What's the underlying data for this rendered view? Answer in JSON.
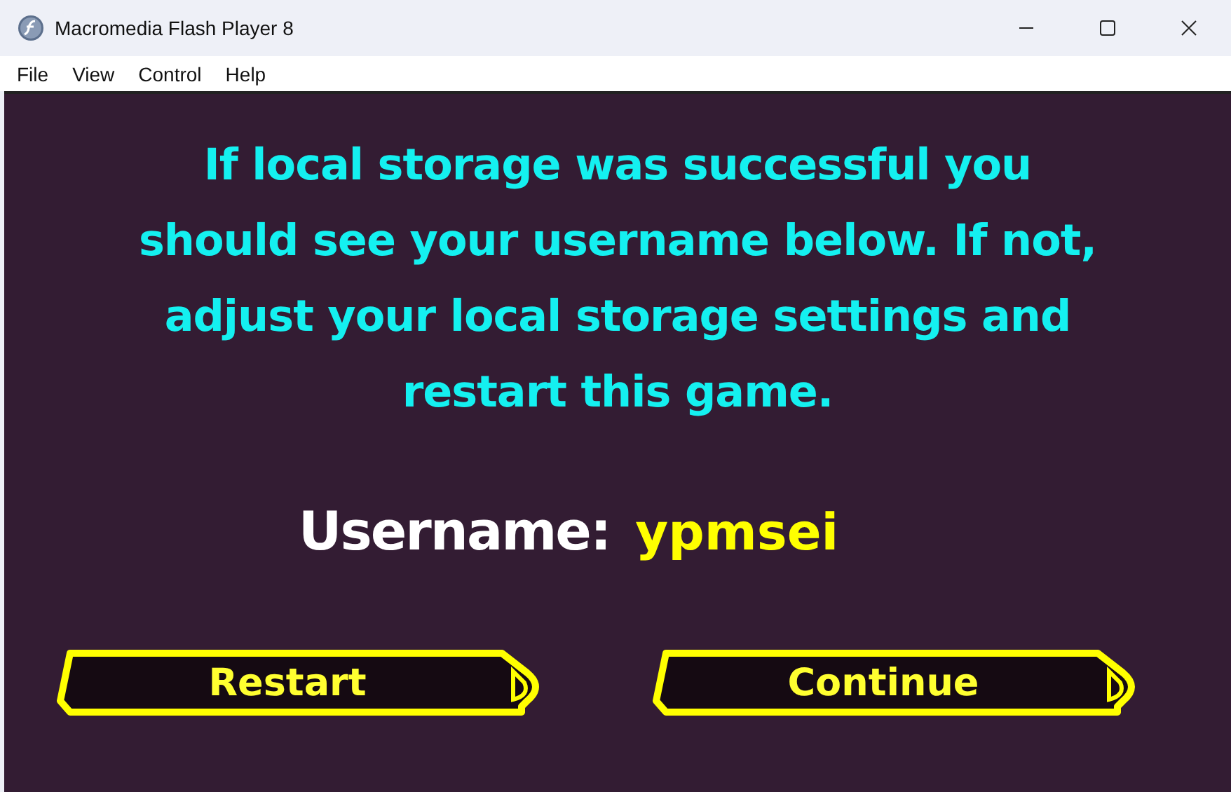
{
  "window": {
    "title": "Macromedia Flash Player 8"
  },
  "menu": [
    "File",
    "View",
    "Control",
    "Help"
  ],
  "message": "If local storage was successful you should see your username below. If not, adjust your local storage settings and restart this game.",
  "username": {
    "label": "Username:",
    "value": "ypmsei"
  },
  "buttons": [
    "Restart",
    "Continue"
  ]
}
